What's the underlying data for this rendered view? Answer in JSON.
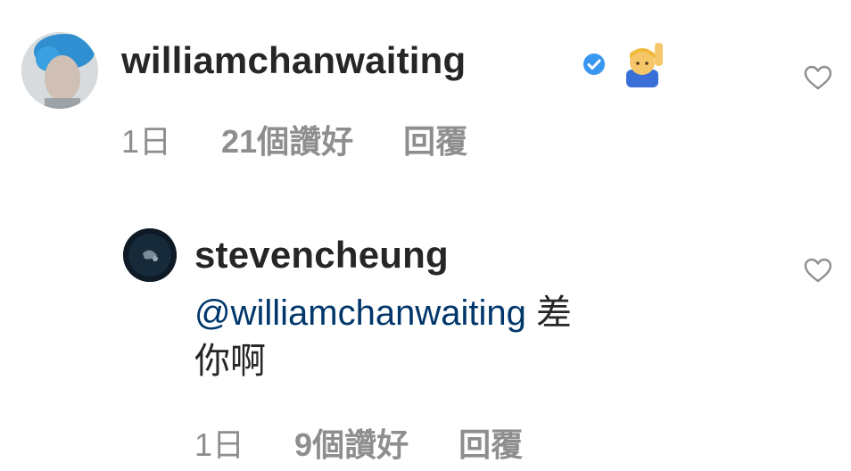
{
  "comments": [
    {
      "username": "williamchanwaiting",
      "verified": true,
      "emoji": "🙋‍♂️",
      "time": "1日",
      "likes": "21個讚好",
      "reply": "回覆",
      "avatar_icon": "profile-photo-blue-hair"
    },
    {
      "username": "stevencheung",
      "mention": "@williamchanwaiting",
      "text_line1": "差",
      "text_line2": "你啊",
      "time": "1日",
      "likes": "9個讚好",
      "reply": "回覆",
      "avatar_icon": "profile-photo-dark"
    }
  ],
  "colors": {
    "primary_text": "#262626",
    "secondary_text": "#8e8e8e",
    "mention": "#00376b",
    "verified_badge": "#3897f0"
  },
  "icons": [
    "heart-outline-icon",
    "verified-badge-icon"
  ]
}
